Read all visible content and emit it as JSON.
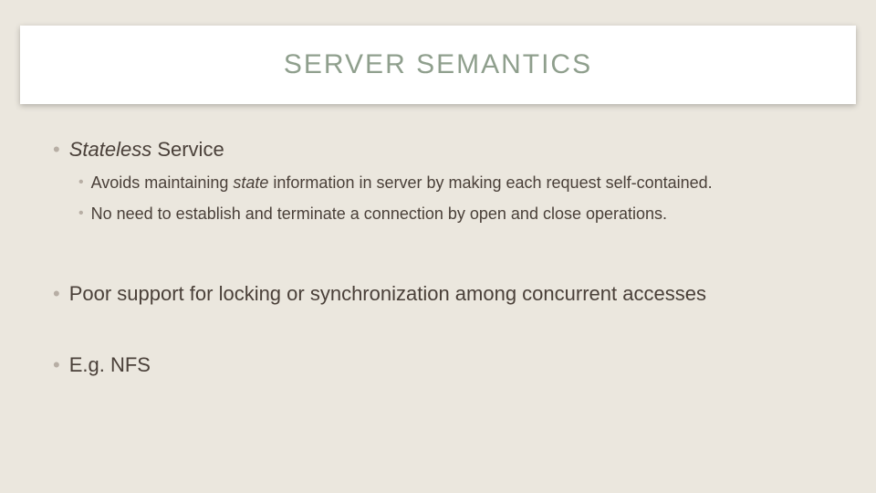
{
  "title": "SERVER SEMANTICS",
  "bullets": {
    "b1_prefix_italic": "Stateless",
    "b1_rest": " Service",
    "b1_sub1_pre": "Avoids maintaining ",
    "b1_sub1_italic": "state",
    "b1_sub1_post": " information in server by making each request self-contained.",
    "b1_sub2": "No need to establish and terminate a connection by open and close operations.",
    "b2": "Poor support for locking or synchronization among concurrent accesses",
    "b3": "E.g. NFS"
  }
}
